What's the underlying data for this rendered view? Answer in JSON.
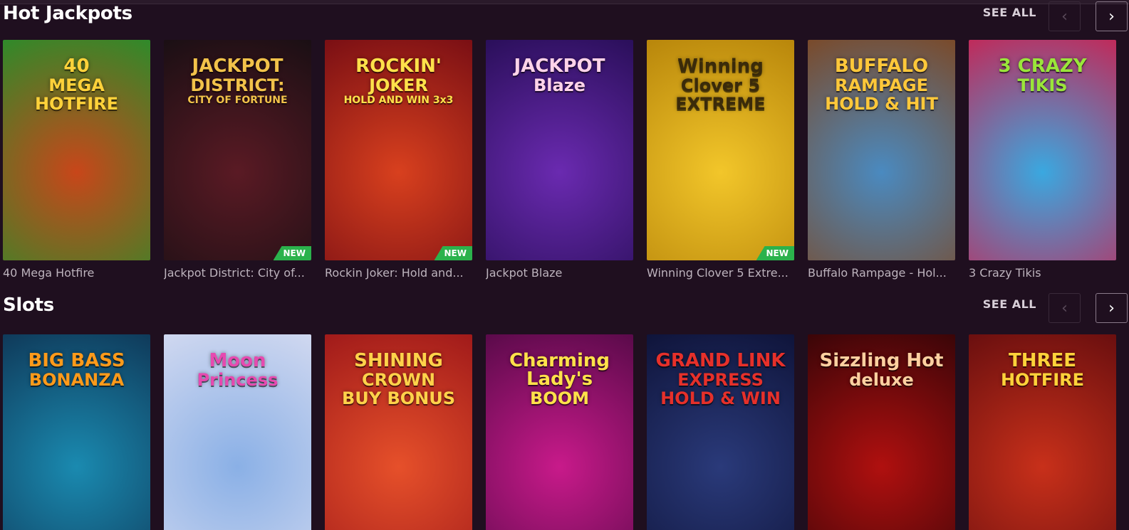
{
  "sections": [
    {
      "title": "Hot Jackpots",
      "see_all": "SEE ALL",
      "prev_icon": "‹",
      "next_icon": "›",
      "games": [
        {
          "name": "40 Mega Hotfire",
          "logo": "40\nMEGA\nHOTFIRE",
          "badge": "",
          "bg": "#c8461a",
          "bg2": "#2f8a2a",
          "logo_color": "#ffd23a"
        },
        {
          "name": "Jackpot District: City of Fortune",
          "logo": "JACKPOT\nDISTRICT:\nCITY OF FORTUNE",
          "badge": "NEW",
          "bg": "#5a1a24",
          "bg2": "#1a0f14",
          "logo_color": "#f2c24a"
        },
        {
          "name": "Rockin Joker: Hold and Win 3x3",
          "logo": "ROCKIN'\nJOKER\nHOLD AND WIN 3x3",
          "badge": "NEW",
          "bg": "#d8401e",
          "bg2": "#7a0f14",
          "logo_color": "#ffe14a"
        },
        {
          "name": "Jackpot Blaze",
          "logo": "JACKPOT\nBlaze",
          "badge": "",
          "bg": "#6a2ab0",
          "bg2": "#2a0f5a",
          "logo_color": "#ffd3e9"
        },
        {
          "name": "Winning Clover 5 Extreme",
          "logo": "Winning\nClover 5\nEXTREME",
          "badge": "NEW",
          "bg": "#f2c62a",
          "bg2": "#b8860b",
          "logo_color": "#3a2a0a"
        },
        {
          "name": "Buffalo Rampage - Hold & Hit",
          "logo": "BUFFALO\nRAMPAGE\nHOLD & HIT",
          "badge": "",
          "bg": "#4a8ac0",
          "bg2": "#7a4a2a",
          "logo_color": "#ffc83a"
        },
        {
          "name": "3 Crazy Tikis",
          "logo": "3 CRAZY\nTIKIS",
          "badge": "",
          "bg": "#3aa8e0",
          "bg2": "#c02a5a",
          "logo_color": "#9ae63a"
        }
      ]
    },
    {
      "title": "Slots",
      "see_all": "SEE ALL",
      "prev_icon": "‹",
      "next_icon": "›",
      "games": [
        {
          "name": "Big Bass Bonanza",
          "logo": "BIG BASS\nBONANZA",
          "badge": "",
          "bg": "#1a8ab0",
          "bg2": "#0f3a5a",
          "logo_color": "#ff9a1a"
        },
        {
          "name": "Moon Princess",
          "logo": "Moon\nPrincess",
          "badge": "",
          "bg": "#8ab0e6",
          "bg2": "#d0d8f0",
          "logo_color": "#e64ab0"
        },
        {
          "name": "Shining Crown",
          "logo": "SHINING\nCROWN\nBUY BONUS",
          "badge": "",
          "bg": "#e6502a",
          "bg2": "#a01a1a",
          "logo_color": "#ffd24a"
        },
        {
          "name": "Charming Lady's Boom",
          "logo": "Charming Lady's\nBOOM",
          "badge": "",
          "bg": "#c81a8a",
          "bg2": "#5a0a4a",
          "logo_color": "#ffe14a"
        },
        {
          "name": "Grand Link Express: Hold & Win",
          "logo": "GRAND LINK\nEXPRESS\nHOLD & WIN",
          "badge": "",
          "bg": "#2a3a7a",
          "bg2": "#0f143a",
          "logo_color": "#e6302a"
        },
        {
          "name": "Sizzling Hot Deluxe",
          "logo": "Sizzling Hot\ndeluxe",
          "badge": "",
          "bg": "#b0100f",
          "bg2": "#3a0508",
          "logo_color": "#ffd0a0"
        },
        {
          "name": "Three Hotfire",
          "logo": "THREE\nHOTFIRE",
          "badge": "",
          "bg": "#c8301a",
          "bg2": "#6a0f0f",
          "logo_color": "#ffd23a"
        }
      ]
    }
  ],
  "captions_display": [
    [
      "40 Mega Hotfire",
      "Jackpot District: City of...",
      "Rockin Joker: Hold and...",
      "Jackpot Blaze",
      "Winning Clover 5 Extre...",
      "Buffalo Rampage - Hol...",
      "3 Crazy Tikis"
    ],
    [
      "",
      "",
      "",
      "",
      "",
      "",
      ""
    ]
  ]
}
